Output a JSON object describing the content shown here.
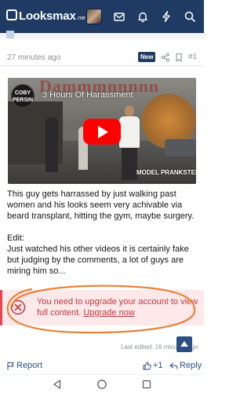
{
  "header": {
    "logo_text": "Looksmax",
    "logo_suffix": ".me",
    "icons": [
      "mail-icon",
      "bell-icon",
      "lightning-icon",
      "search-icon"
    ]
  },
  "post": {
    "time": "27 minutes ago",
    "badge": "New",
    "number": "#1",
    "video": {
      "channel_logo_text": "COBY PERSIN",
      "title_bg": "Dammmnnnnn",
      "title": "3 Hours Of Harassment",
      "watermark": "MODEL PRANKSTERS"
    },
    "body": [
      "This guy gets harrassed by just walking past women and his looks seem very achivable via beard transplant, hitting the gym, maybe surgery.",
      "Edit:",
      "Just watched his other videos it is certainly fake but judging by the comments, a lot of guys are miring him so..."
    ],
    "notice": {
      "message": "You need to upgrade your account to view full content.",
      "link": "Upgrade now"
    },
    "last_edited": "Last edited: 16 minutes ago",
    "actions": {
      "report": "Report",
      "likes": "+1",
      "reply": "Reply"
    }
  },
  "colors": {
    "header_bg": "#1f3a63",
    "accent": "#2d4f7f",
    "notice_bg": "#fde8ea",
    "notice_text": "#c0383f",
    "annotation_orange": "#e8833a"
  }
}
